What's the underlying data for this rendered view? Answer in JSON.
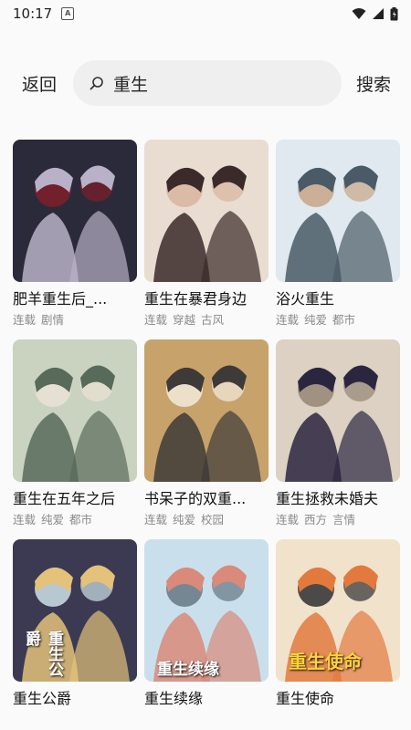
{
  "status_bar": {
    "time": "10:17",
    "notification_letter": "A"
  },
  "header": {
    "back_label": "返回",
    "search_value": "重生",
    "search_button": "搜索"
  },
  "results": [
    {
      "title": "肥羊重生后_...",
      "tags": [
        "连载",
        "剧情"
      ],
      "palette": [
        "#2b2a3a",
        "#b9b1c7",
        "#7a1f2a"
      ]
    },
    {
      "title": "重生在暴君身边",
      "tags": [
        "连载",
        "穿越",
        "古风"
      ],
      "palette": [
        "#e8ddd0",
        "#3a2a2a",
        "#d9b7a0"
      ]
    },
    {
      "title": "浴火重生",
      "tags": [
        "连载",
        "纯爱",
        "都市"
      ],
      "palette": [
        "#dfe9ef",
        "#4a5a66",
        "#c9a98d"
      ]
    },
    {
      "title": "重生在五年之后",
      "tags": [
        "连载",
        "纯爱",
        "都市"
      ],
      "palette": [
        "#c9d3c0",
        "#586a5a",
        "#e8e1d3"
      ]
    },
    {
      "title": "书呆子的双重...",
      "tags": [
        "连载",
        "纯爱",
        "校园"
      ],
      "palette": [
        "#c7a26b",
        "#3d3a37",
        "#f1e7d6"
      ]
    },
    {
      "title": "重生拯救未婚夫",
      "tags": [
        "连载",
        "西方",
        "言情"
      ],
      "palette": [
        "#dcd1c2",
        "#2b2640",
        "#9a8a7a"
      ]
    },
    {
      "title": "重生公爵",
      "tags": [],
      "palette": [
        "#3b3a52",
        "#e4c27a",
        "#c6d8e0"
      ],
      "cover_text": "重生公爵"
    },
    {
      "title": "重生续缘",
      "tags": [],
      "palette": [
        "#c9e0ec",
        "#d98a7a",
        "#6a7d8a"
      ],
      "cover_text": "重生续缘"
    },
    {
      "title": "重生使命",
      "tags": [],
      "palette": [
        "#f1e2cc",
        "#e27a3e",
        "#3a3a3a"
      ],
      "cover_text": "重生使命"
    }
  ]
}
